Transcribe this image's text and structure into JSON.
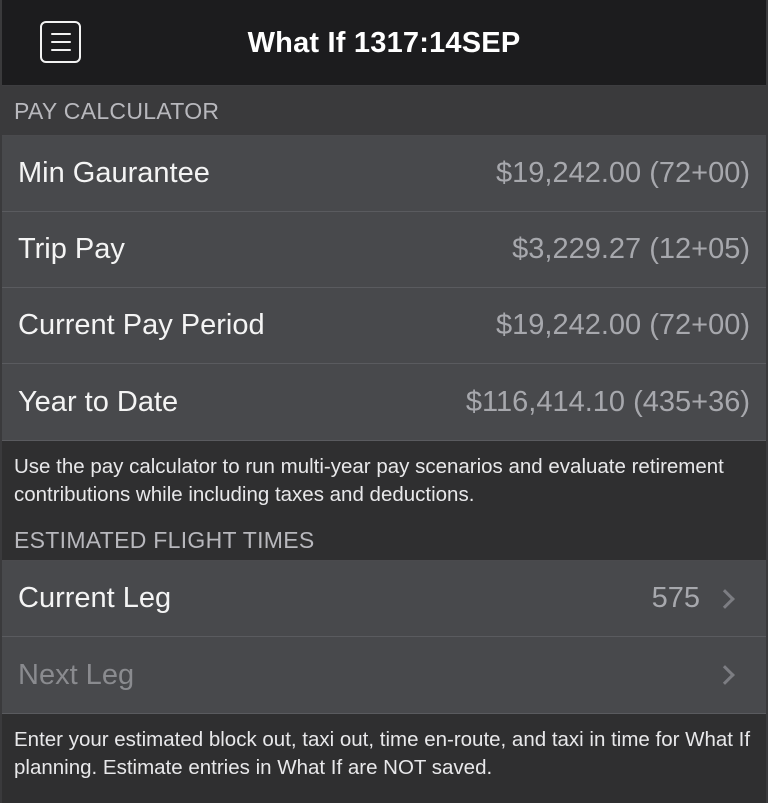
{
  "nav": {
    "title": "What If 1317:14SEP",
    "menu_icon": "hamburger-menu-icon"
  },
  "pay_calculator": {
    "header": "PAY CALCULATOR",
    "rows": [
      {
        "label": "Min Gaurantee",
        "value": "$19,242.00 (72+00)"
      },
      {
        "label": "Trip Pay",
        "value": "$3,229.27 (12+05)"
      },
      {
        "label": "Current Pay Period",
        "value": "$19,242.00 (72+00)"
      },
      {
        "label": "Year to Date",
        "value": "$116,414.10 (435+36)"
      }
    ],
    "footer": "Use the pay calculator to run multi-year pay scenarios and evaluate retirement contributions while including taxes and deductions."
  },
  "flight_times": {
    "header": "ESTIMATED FLIGHT TIMES",
    "rows": [
      {
        "label": "Current Leg",
        "value": "575",
        "enabled": true
      },
      {
        "label": "Next Leg",
        "value": "",
        "enabled": false
      }
    ],
    "footer": "Enter your estimated block out, taxi out, time en-route, and taxi in time for What If planning. Estimate entries in What If are NOT saved."
  },
  "colors": {
    "navbar_bg": "#1c1c1e",
    "cell_bg": "#48494c",
    "header_bg": "#3a3a3c",
    "text_primary": "#f4f4f4",
    "text_secondary": "#a7a8ad"
  }
}
